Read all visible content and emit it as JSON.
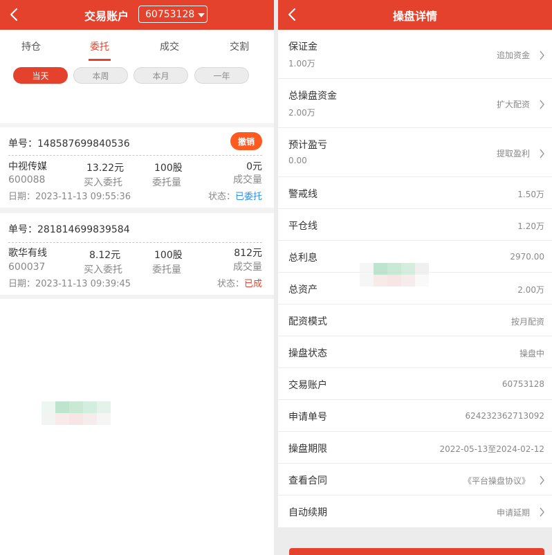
{
  "left": {
    "header": {
      "title": "交易账户",
      "account": "60753128"
    },
    "tabs": [
      {
        "label": "持仓"
      },
      {
        "label": "委托",
        "active": true
      },
      {
        "label": "成交"
      },
      {
        "label": "交割"
      }
    ],
    "period_chips": [
      {
        "label": "当天",
        "active": true
      },
      {
        "label": "本周"
      },
      {
        "label": "本月"
      },
      {
        "label": "一年"
      }
    ],
    "orders": [
      {
        "order_no": "单号：148587699840536",
        "revoke_label": "撤销",
        "stock_name": "中视传媒",
        "stock_code": "600088",
        "price": "13.22元",
        "price_label": "买入委托",
        "quantity": "100股",
        "quantity_label": "委托量",
        "deal_amount": "0元",
        "deal_label": "成交量",
        "date": "日期：2023-11-13 09:55:36",
        "status_label": "状态：",
        "status": "已委托",
        "status_color": "#2c8df0"
      },
      {
        "order_no": "单号：281814699839584",
        "stock_name": "歌华有线",
        "stock_code": "600037",
        "price": "8.12元",
        "price_label": "买入委托",
        "quantity": "100股",
        "quantity_label": "委托量",
        "deal_amount": "812元",
        "deal_label": "成交量",
        "date": "日期：2023-11-13 09:39:45",
        "status_label": "状态：",
        "status": "已成",
        "status_color": "#e4422d"
      }
    ]
  },
  "right": {
    "header": {
      "title": "操盘详情"
    },
    "rows": [
      {
        "label": "保证金",
        "sub": "1.00万",
        "value": "追加资金",
        "arrow": true
      },
      {
        "label": "总操盘资金",
        "sub": "2.00万",
        "value": "扩大配资",
        "arrow": true
      },
      {
        "label": "预计盈亏",
        "sub": "0.00",
        "value": "提取盈利",
        "arrow": true
      },
      {
        "label": "警戒线",
        "value": "1.50万"
      },
      {
        "label": "平仓线",
        "value": "1.20万"
      },
      {
        "label": "总利息",
        "value": "2970.00"
      },
      {
        "label": "总资产",
        "value": "2.00万"
      },
      {
        "label": "配资模式",
        "value": "按月配资"
      },
      {
        "label": "操盘状态",
        "value": "操盘中"
      },
      {
        "label": "交易账户",
        "value": "60753128"
      },
      {
        "label": "申请单号",
        "value": "624232362713092"
      },
      {
        "label": "操盘期限",
        "value": "2022-05-13至2024-02-12"
      },
      {
        "label": "查看合同",
        "value": "《平台操盘协议》",
        "arrow": true
      },
      {
        "label": "自动续期",
        "value": "申请延期",
        "arrow": true
      }
    ]
  },
  "colors": {
    "brand_red": "#e4422d",
    "revoke_orange": "#ff5a1f"
  },
  "icons": {
    "back": "chevron-left-icon",
    "dropdown": "caret-down-icon",
    "row_arrow": "chevron-right-icon"
  }
}
